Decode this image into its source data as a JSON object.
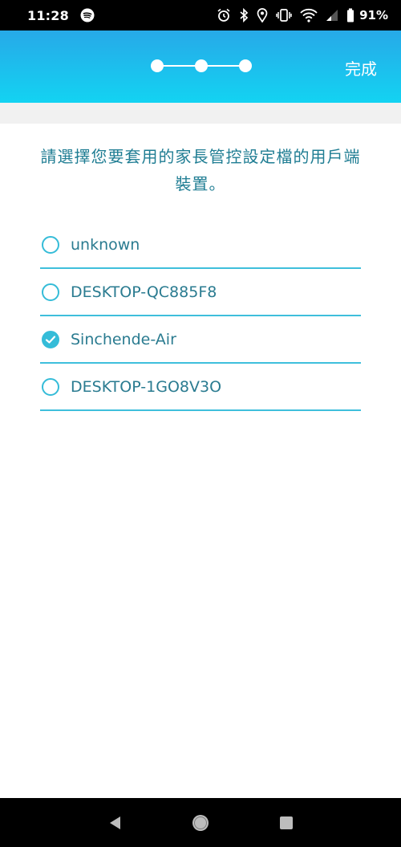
{
  "status_bar": {
    "time": "11:28",
    "battery": "91%",
    "icons": [
      "spotify-icon",
      "alarm-icon",
      "bluetooth-icon",
      "location-icon",
      "vibrate-icon",
      "wifi-icon",
      "signal-icon",
      "battery-icon"
    ]
  },
  "header": {
    "steps_total": 3,
    "done_label": "完成"
  },
  "instruction": "請選擇您要套用的家長管控設定檔的用戶端裝置。",
  "devices": [
    {
      "name": "unknown",
      "selected": false
    },
    {
      "name": "DESKTOP-QC885F8",
      "selected": false
    },
    {
      "name": "Sinchende-Air",
      "selected": true
    },
    {
      "name": "DESKTOP-1GO8V3O",
      "selected": false
    }
  ],
  "colors": {
    "accent": "#35bcd8",
    "text": "#2a7b90",
    "header_top": "#27a9e8",
    "header_bottom": "#13d3f2"
  },
  "nav": {
    "icons": [
      "back-icon",
      "home-icon",
      "recents-icon"
    ]
  }
}
